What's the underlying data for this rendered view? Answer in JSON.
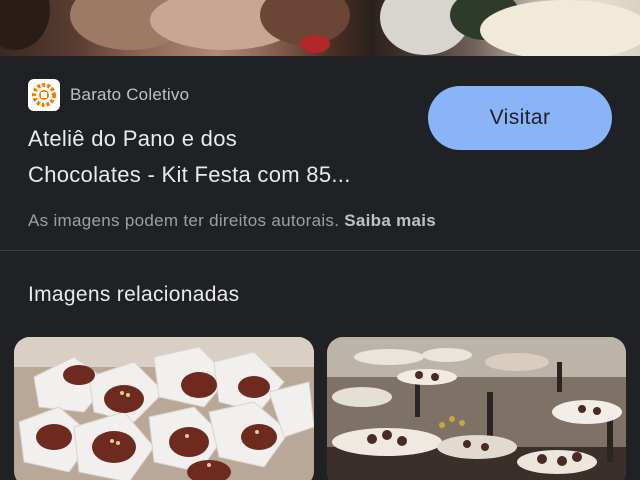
{
  "source": {
    "site_name": "Barato Coletivo",
    "logo_icon": "barato-coletivo-logo-icon"
  },
  "result": {
    "title_line1": "Ateliê do Pano e dos",
    "title_line2": "Chocolates - Kit Festa com 85...",
    "visit_label": "Visitar"
  },
  "notice": {
    "copyright_text": "As imagens podem ter direitos autorais.",
    "learn_more": "Saiba mais"
  },
  "related": {
    "section_title": "Imagens relacionadas",
    "images": [
      {
        "subject": "chocolate bonbons in white paper wrappers"
      },
      {
        "subject": "dessert table with bonbons on stands"
      }
    ]
  },
  "colors": {
    "background": "#202124",
    "accent_button": "#8ab4f8",
    "text_primary": "#e8eaed",
    "text_secondary": "#9aa0a6"
  }
}
